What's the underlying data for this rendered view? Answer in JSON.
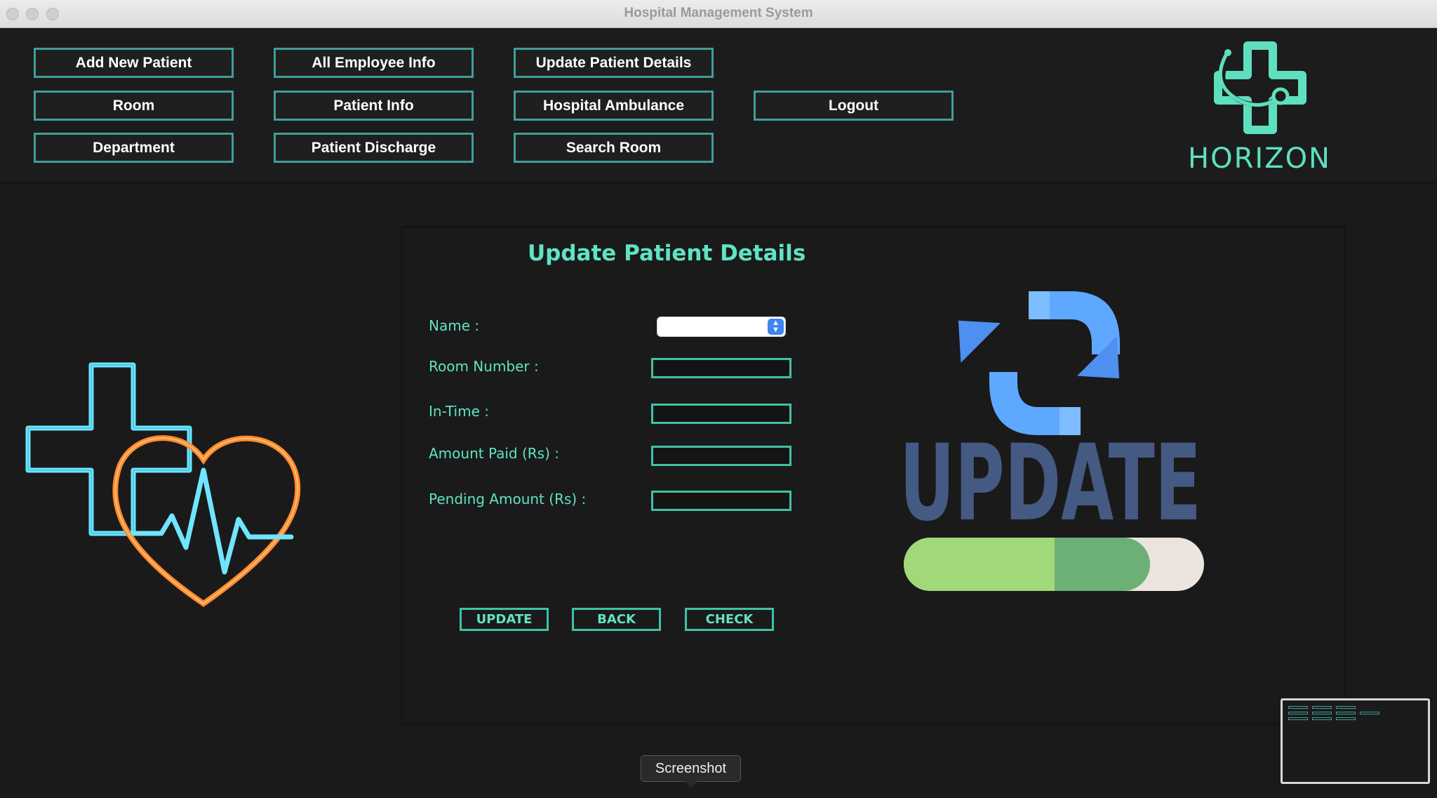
{
  "window": {
    "title": "Hospital Management System"
  },
  "nav": {
    "row1": [
      "Add New Patient",
      "All Employee Info",
      "Update Patient Details"
    ],
    "row2": [
      "Room",
      "Patient Info",
      "Hospital Ambulance",
      "Logout"
    ],
    "row3": [
      "Department",
      "Patient Discharge",
      "Search Room"
    ]
  },
  "logo": {
    "text": "HORIZON",
    "color": "#5ee0bf"
  },
  "form": {
    "title": "Update Patient Details",
    "labels": {
      "name": "Name :",
      "room": "Room Number :",
      "intime": "In-Time  :",
      "paid": "Amount Paid (Rs) :",
      "pending": "Pending Amount (Rs) :"
    },
    "values": {
      "name": "",
      "room": "",
      "intime": "",
      "paid": "",
      "pending": ""
    },
    "buttons": {
      "update": "UPDATE",
      "back": "BACK",
      "check": "CHECK"
    }
  },
  "art": {
    "update_word": "UPDATE",
    "progress": 0.82
  },
  "tooltip": "Screenshot",
  "colors": {
    "accent": "#5fe3c3",
    "border": "#3f9e98",
    "bg": "#1a1a1a"
  }
}
